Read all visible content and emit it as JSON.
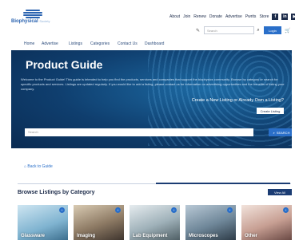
{
  "brand": {
    "name": "Biophysical",
    "suffix": "Society",
    "accent": "#2a63b0"
  },
  "utility_nav": [
    "About",
    "Join",
    "Renew",
    "Donate",
    "Advertise",
    "Pwrits",
    "Store"
  ],
  "social_icons": [
    "f",
    "in",
    "yt",
    "tw"
  ],
  "main_nav": [
    "Home",
    "Advertise",
    "Listings",
    "Categories",
    "Contact Us",
    "Dashboard"
  ],
  "header_search": {
    "placeholder": "Search"
  },
  "login_label": "Login",
  "hero": {
    "title": "Product Guide",
    "description": "Welcome to the Product Guide! This guide is intended to help you find the products, services and companies that support the biophysics community. Browse by category or search for specific products and services. Listings are updated regularly. If you would like to add a listing, please contact us for information on advertising opportunities and the benefits of listing your company.",
    "cta_text": "Create a New Listing or Already Own a Listing?",
    "cta_button": "Create Listing",
    "search_placeholder": "Search",
    "search_button": "SEARCH"
  },
  "back_link": "Back to Guide",
  "browse": {
    "title": "Browse Listings by Category",
    "view_all": "View All"
  },
  "categories": [
    {
      "label": "Glassware",
      "count": ""
    },
    {
      "label": "Imaging",
      "count": ""
    },
    {
      "label": "Lab Equipment",
      "count": ""
    },
    {
      "label": "Microscopes",
      "count": ""
    },
    {
      "label": "Other",
      "count": ""
    }
  ]
}
